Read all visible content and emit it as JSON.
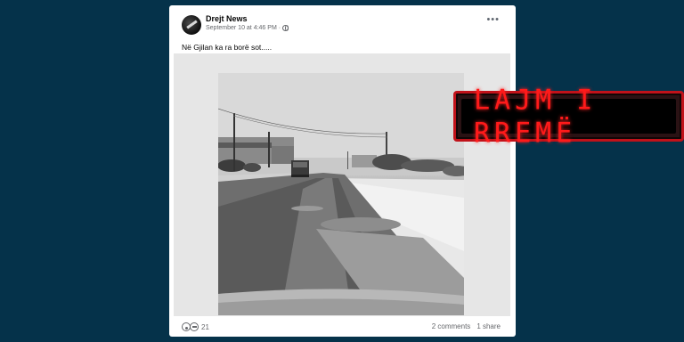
{
  "post": {
    "author": "Drejt News",
    "timestamp": "September 10 at 4:46 PM",
    "separator": "·",
    "text": "Në Gjilan ka ra borë sot.....",
    "more_label": "•••",
    "reaction_count": "21",
    "comments": "2 comments",
    "shares": "1 share"
  },
  "badge": {
    "text": "LAJM I RREMË",
    "color": "#ff1a1a"
  },
  "icons": {
    "privacy": "globe-icon",
    "reactions": [
      "wow-reaction-icon",
      "care-reaction-icon"
    ]
  },
  "colors": {
    "background": "#05324a",
    "card": "#ffffff",
    "badge_border": "#c0121a"
  }
}
